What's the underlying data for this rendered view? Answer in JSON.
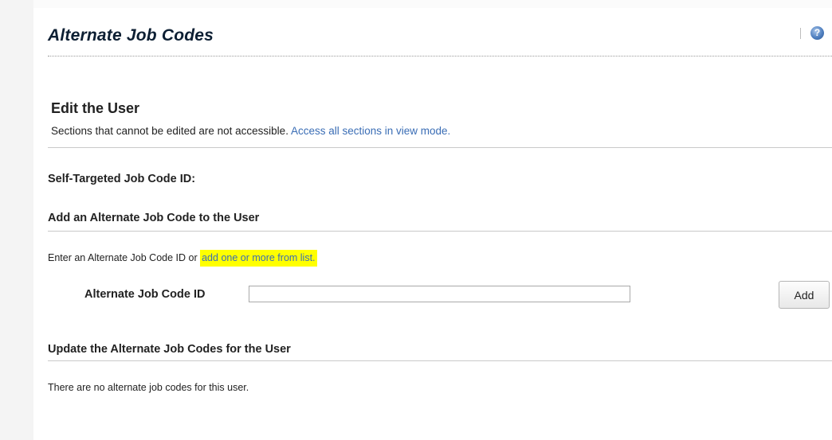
{
  "header": {
    "title": "Alternate Job Codes",
    "divider_glyph": "|",
    "help_icon_glyph": "?"
  },
  "edit_section": {
    "heading": "Edit the User",
    "description": "Sections that cannot be edited are not accessible.",
    "view_mode_link": "Access all sections in view mode."
  },
  "self_targeted": {
    "label": "Self-Targeted Job Code ID:"
  },
  "add_section": {
    "heading": "Add an Alternate Job Code to the User",
    "instruction_prefix": "Enter an Alternate Job Code ID or",
    "list_link": "add one or more from list.",
    "field_label": "Alternate Job Code ID",
    "field_value": "",
    "add_button": "Add"
  },
  "update_section": {
    "heading": "Update the Alternate Job Codes for the User",
    "empty_message": "There are no alternate job codes for this user."
  },
  "colors": {
    "link": "#3a6db5",
    "highlight": "#ffff00",
    "title": "#0d1f33"
  },
  "icons": {
    "help": "help-icon"
  }
}
